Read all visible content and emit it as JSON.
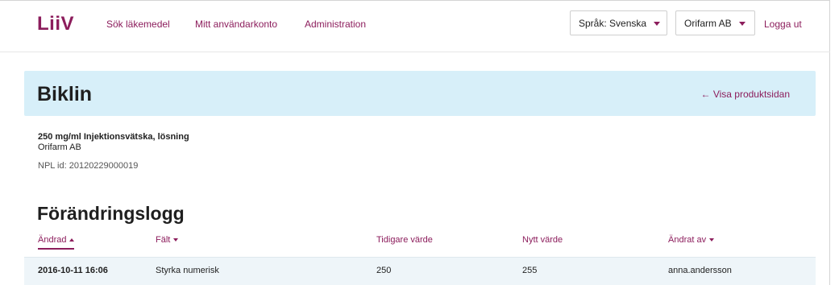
{
  "nav": {
    "logo": "LiiV",
    "links": [
      "Sök läkemedel",
      "Mitt användarkonto",
      "Administration"
    ],
    "language_dropdown": "Språk: Svenska",
    "company_dropdown": "Orifarm AB",
    "logout": "Logga ut"
  },
  "hero": {
    "title": "Biklin",
    "back_link": "← Visa produktsidan"
  },
  "product": {
    "strength": "250 mg/ml Injektionsvätska, lösning",
    "company": "Orifarm AB",
    "npl": "NPL id: 20120229000019"
  },
  "changelog": {
    "title": "Förändringslogg",
    "headers": [
      "Ändrad",
      "Fält",
      "Tidigare värde",
      "Nytt värde",
      "Ändrat av"
    ],
    "rows": [
      [
        "2016-10-11 16:06",
        "Styrka numerisk",
        "250",
        "255",
        "anna.andersson"
      ]
    ]
  },
  "colors": {
    "accent": "#8c1d5c",
    "hero_bg": "#d7eff9",
    "row_bg": "#eef5f9"
  }
}
